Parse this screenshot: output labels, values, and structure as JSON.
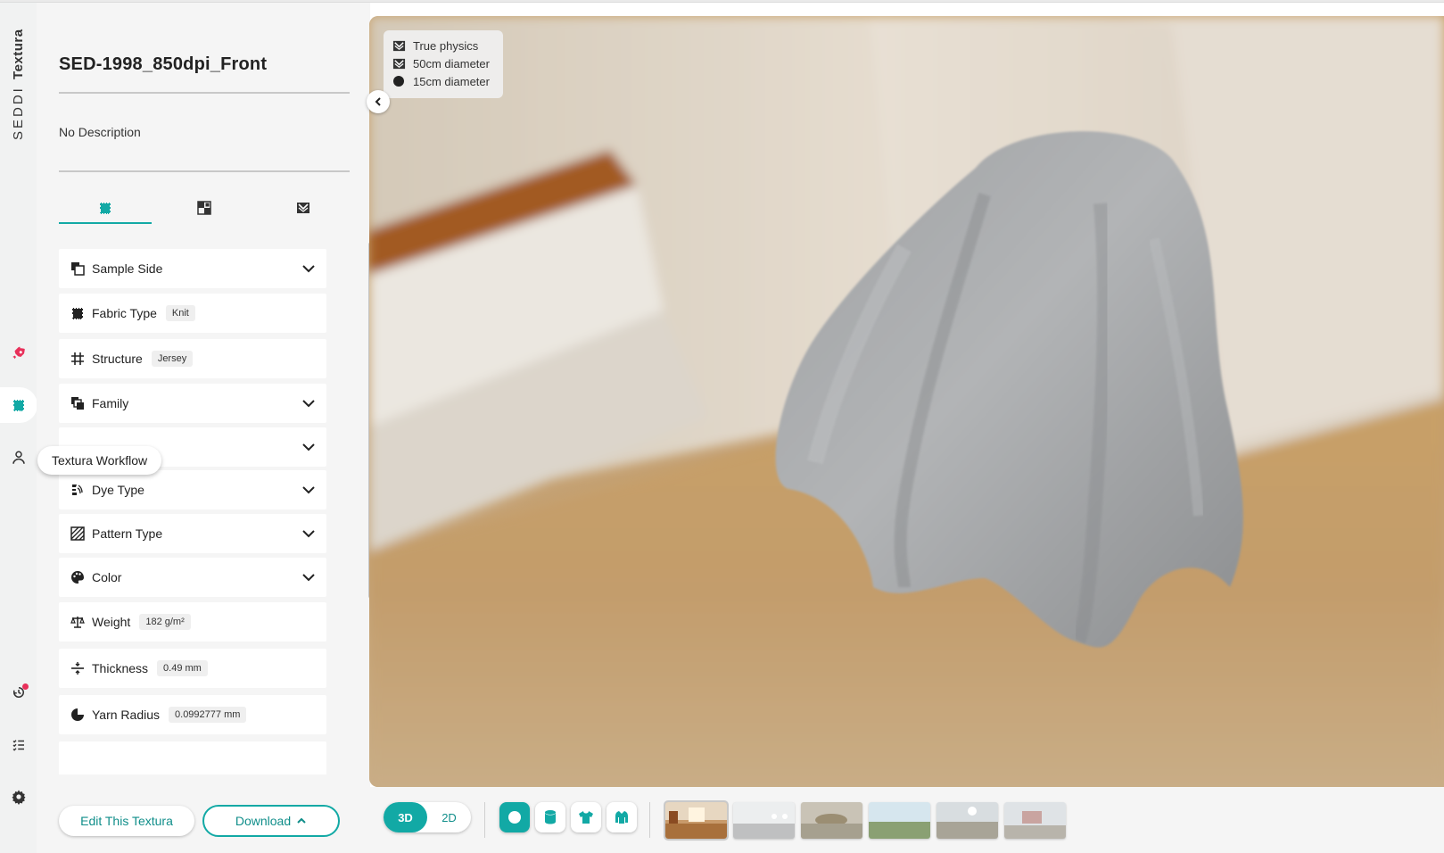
{
  "app": {
    "brand_light": "SEDDI",
    "brand_bold": "Textura"
  },
  "rail": {
    "tooltip": "Textura Workflow",
    "icons": [
      "rocket-icon",
      "fabric-icon",
      "person-icon",
      "history-icon",
      "list-icon",
      "gear-icon"
    ]
  },
  "panel": {
    "title": "SED-1998_850dpi_Front",
    "description": "No Description",
    "tabs": [
      "tab-fabric-icon",
      "tab-maps-icon",
      "tab-physics-icon"
    ],
    "properties": [
      {
        "label": "Sample Side",
        "icon": "sample-side-icon",
        "expandable": true
      },
      {
        "label": "Fabric Type",
        "value": "Knit",
        "icon": "fabric-type-icon"
      },
      {
        "label": "Structure",
        "value": "Jersey",
        "icon": "structure-grid-icon"
      },
      {
        "label": "Family",
        "icon": "family-icon",
        "expandable": true
      },
      {
        "label": "",
        "icon": "",
        "expandable": true
      },
      {
        "label": "Dye Type",
        "icon": "dye-type-icon",
        "expandable": true
      },
      {
        "label": "Pattern Type",
        "icon": "pattern-type-icon",
        "expandable": true
      },
      {
        "label": "Color",
        "icon": "palette-icon",
        "expandable": true
      },
      {
        "label": "Weight",
        "value": "182 g/m²",
        "icon": "scale-icon"
      },
      {
        "label": "Thickness",
        "value": "0.49 mm",
        "icon": "thickness-icon"
      },
      {
        "label": "Yarn Radius",
        "value": "0.0992777 mm",
        "icon": "yarn-radius-icon"
      }
    ],
    "edit_label": "Edit This Textura",
    "download_label": "Download"
  },
  "viewport": {
    "legend": [
      {
        "label": "True physics",
        "icon": "physics-icon"
      },
      {
        "label": "50cm diameter",
        "icon": "physics-icon"
      },
      {
        "label": "15cm diameter",
        "icon": "dot-icon"
      }
    ]
  },
  "bottombar": {
    "mode_3d": "3D",
    "mode_2d": "2D",
    "shapes": [
      "sphere-icon",
      "cylinder-icon",
      "tshirt-icon",
      "jacket-icon"
    ],
    "environments": [
      "env-interior",
      "env-studio",
      "env-dusk",
      "env-field",
      "env-overcast",
      "env-street"
    ]
  },
  "colors": {
    "accent": "#12a9a5",
    "accent_dark": "#108e8a",
    "badge": "#e8305a"
  }
}
